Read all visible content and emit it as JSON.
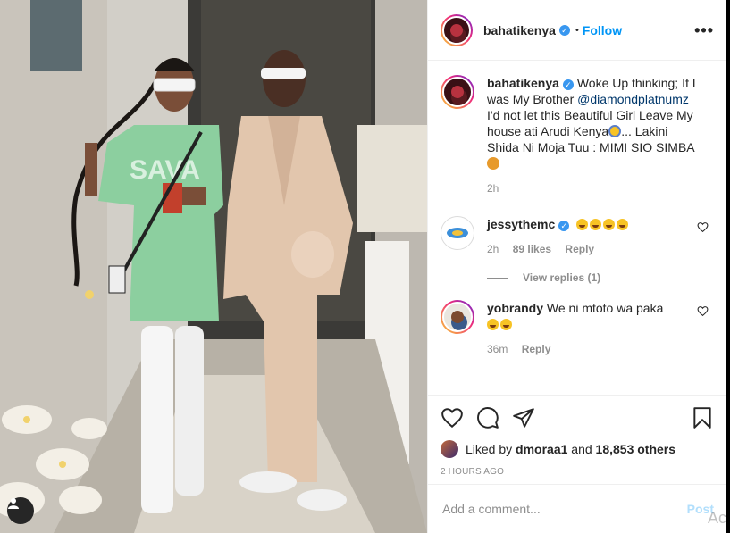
{
  "header": {
    "username": "bahatikenya",
    "separator": "•",
    "follow_label": "Follow",
    "more_label": "•••"
  },
  "caption": {
    "username": "bahatikenya",
    "text_part1": "Woke Up thinking; If I was My Brother ",
    "mention": "@diamondplatnumz",
    "text_part2": " I'd not let this Beautiful Girl Leave My house ati Arudi Kenya",
    "text_part3": "... Lakini Shida Ni Moja Tuu : MIMI SIO SIMBA ",
    "age": "2h"
  },
  "comments": [
    {
      "username": "jessythemc",
      "age": "2h",
      "likes": "89 likes",
      "reply_label": "Reply",
      "view_replies": "View replies (1)"
    },
    {
      "username": "yobrandy",
      "text": "We ni mtoto wa paka",
      "age": "36m",
      "reply_label": "Reply"
    }
  ],
  "likes": {
    "prefix": "Liked by ",
    "user": "dmoraa1",
    "middle": " and ",
    "count": "18,853 others"
  },
  "timestamp": "2 HOURS AGO",
  "add_comment": {
    "placeholder": "Add a comment...",
    "post_label": "Post"
  },
  "watermark": "Ac",
  "icons": {
    "like": "heart-icon",
    "comment": "comment-icon",
    "share": "paper-plane-icon",
    "save": "bookmark-icon",
    "verified": "verified-badge-icon",
    "user_tag": "user-tag-icon"
  },
  "colors": {
    "accent": "#0095f6",
    "verified": "#3897f0",
    "post_disabled": "#b2dffc",
    "muted": "#8e8e8e"
  }
}
